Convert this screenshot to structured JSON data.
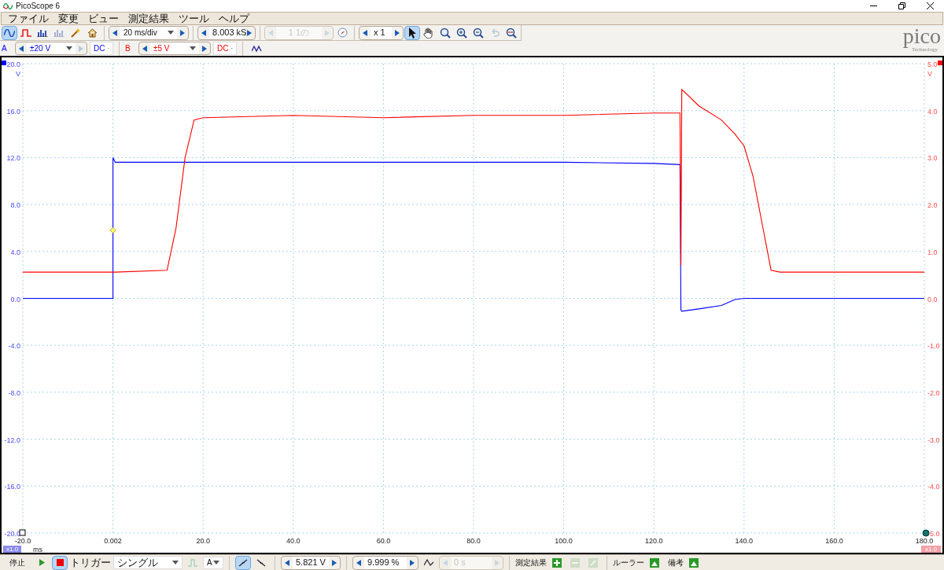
{
  "window": {
    "title": "PicoScope 6"
  },
  "menu": [
    "ファイル",
    "変更",
    "ビュー",
    "測定結果",
    "ツール",
    "ヘルプ"
  ],
  "modes": [
    {
      "kind": "scope",
      "selected": true
    },
    {
      "kind": "persistence",
      "selected": false
    },
    {
      "kind": "spectrum",
      "selected": false
    },
    {
      "kind": "spectrum",
      "selected": false,
      "disabled": true
    }
  ],
  "timebase": "20 ms/div",
  "samples": "8.003 kS",
  "buffer": "1 1の",
  "zoom": "x 1",
  "tools": [
    {
      "kind": "pointer",
      "selected": true
    },
    {
      "kind": "hand",
      "selected": false
    },
    {
      "kind": "zoom",
      "selected": false
    },
    {
      "kind": "zoom-in",
      "selected": false
    },
    {
      "kind": "zoom-out",
      "selected": false
    },
    {
      "kind": "undo",
      "selected": false,
      "disabled": true
    },
    {
      "kind": "zoom-fit",
      "selected": false
    }
  ],
  "logo": {
    "name": "pico",
    "tagline": "Technology"
  },
  "channels": [
    {
      "range": "±20 V",
      "coupling": "DC",
      "color": "#0000ff"
    },
    {
      "range": "±5 V",
      "coupling": "DC",
      "color": "#ff0000"
    }
  ],
  "chart_data": {
    "type": "line",
    "grid": true,
    "xlabel": "ms",
    "ylabel": "V",
    "y2label": "V",
    "xlim": [
      -20,
      180
    ],
    "ylim": [
      -20,
      20
    ],
    "y2lim": [
      -5,
      5
    ],
    "y2ticks": [
      {
        "value": 5,
        "label": "5.0"
      },
      {
        "value": 4,
        "label": "4.0"
      },
      {
        "value": 3,
        "label": "3.0"
      },
      {
        "value": 2,
        "label": "2.0"
      },
      {
        "value": 1,
        "label": "1.0"
      },
      {
        "value": 0,
        "label": "0.0"
      },
      {
        "value": -1,
        "label": "-1.0"
      },
      {
        "value": -2,
        "label": "-2.0"
      },
      {
        "value": -3,
        "label": "-3.0"
      },
      {
        "value": -4,
        "label": "-4.0"
      },
      {
        "value": -5,
        "label": "-5.0"
      }
    ],
    "xticks": [
      {
        "value": -20,
        "label": "-20.0"
      },
      {
        "value": 0.002,
        "label": "0.002"
      },
      {
        "value": 20,
        "label": "20.0"
      },
      {
        "value": 40,
        "label": "40.0"
      },
      {
        "value": 60,
        "label": "60.0"
      },
      {
        "value": 80,
        "label": "80.0"
      },
      {
        "value": 100,
        "label": "100.0"
      },
      {
        "value": 120,
        "label": "120.0"
      },
      {
        "value": 140,
        "label": "140.0"
      },
      {
        "value": 160,
        "label": "160.0"
      },
      {
        "value": 180,
        "label": "180.0"
      }
    ],
    "yticks": [
      {
        "value": 20,
        "label": "20.0"
      },
      {
        "value": 16,
        "label": "16.0"
      },
      {
        "value": 12,
        "label": "12.0"
      },
      {
        "value": 8,
        "label": "8.0"
      },
      {
        "value": 4,
        "label": "4.0"
      },
      {
        "value": 0,
        "label": "0.0"
      },
      {
        "value": -4,
        "label": "-4.0"
      },
      {
        "value": -8,
        "label": "-8.0"
      },
      {
        "value": -12,
        "label": "-12.0"
      },
      {
        "value": -16,
        "label": "-16.0"
      },
      {
        "value": -20,
        "label": "-20.0"
      }
    ],
    "x": [
      -20,
      0,
      0.002,
      0.5,
      12,
      14,
      16,
      18,
      20,
      40,
      60,
      80,
      100,
      120,
      125.8,
      126,
      126.2,
      130,
      135,
      138,
      140,
      142,
      144,
      146,
      148,
      180
    ],
    "series": [
      {
        "name": "A",
        "color": "#0000ff",
        "values": [
          0,
          0,
          12,
          11.6,
          11.6,
          11.6,
          11.6,
          11.6,
          11.6,
          11.6,
          11.6,
          11.6,
          11.6,
          11.5,
          11.4,
          -1.0,
          -1.1,
          -0.9,
          -0.6,
          -0.1,
          0,
          0,
          0,
          0,
          0,
          0
        ]
      },
      {
        "name": "B",
        "color": "#ff0000",
        "axis": "y2",
        "values": [
          0.56,
          0.56,
          0.56,
          0.56,
          0.6,
          1.5,
          3.0,
          3.8,
          3.85,
          3.9,
          3.85,
          3.9,
          3.9,
          3.95,
          3.95,
          0.7,
          4.45,
          4.1,
          3.8,
          3.5,
          3.25,
          2.6,
          1.6,
          0.6,
          0.56,
          0.56
        ]
      }
    ]
  },
  "zoom_badges": [
    "x1.0",
    "x1.0"
  ],
  "bottom": {
    "stop": "停止",
    "trigger_label": "トリガー",
    "trigger_mode": "シングル",
    "source": "A",
    "edges": [
      {
        "kind": "rising",
        "selected": true
      },
      {
        "kind": "falling",
        "selected": false
      }
    ],
    "threshold": "5.821 V",
    "pretrigger": "9.999 %",
    "delay": "0 s",
    "measurements": "測定結果",
    "rulers": "ルーラー",
    "notes": "備考"
  }
}
